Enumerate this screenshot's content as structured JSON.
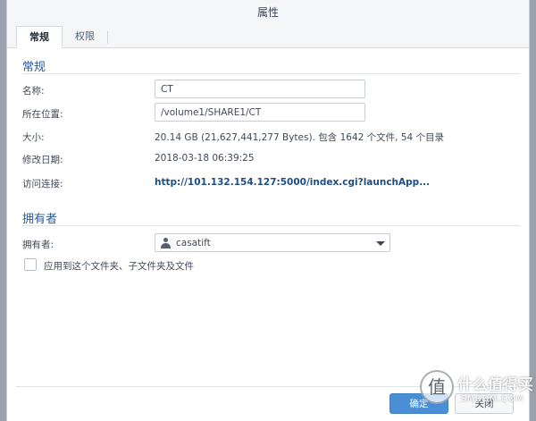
{
  "dialog": {
    "title": "属性"
  },
  "tabs": [
    {
      "label": "常规",
      "active": true
    },
    {
      "label": "权限",
      "active": false
    }
  ],
  "general": {
    "section_title": "常规",
    "name_label": "名称:",
    "name_value": "CT",
    "location_label": "所在位置:",
    "location_value": "/volume1/SHARE1/CT",
    "size_label": "大小:",
    "size_value": "20.14 GB (21,627,441,277 Bytes). 包含 1642 个文件,  54 个目录",
    "modified_label": "修改日期:",
    "modified_value": "2018-03-18 06:39:25",
    "access_label": "访问连接:",
    "access_value": "http://101.132.154.127:5000/index.cgi?launchApp..."
  },
  "owner": {
    "section_title": "拥有者",
    "owner_label": "拥有者:",
    "owner_value": "casatift",
    "apply_label": "应用到这个文件夹、子文件夹及文件",
    "apply_checked": false
  },
  "footer": {
    "ok_label": "确定",
    "cancel_label": "关闭"
  },
  "watermark": {
    "badge": "值",
    "text": "什么值得买",
    "sub": "SMZDM.COM"
  },
  "colors": {
    "accent": "#4a8fd6",
    "section_title": "#2a5a93",
    "link": "#1f4c85"
  }
}
